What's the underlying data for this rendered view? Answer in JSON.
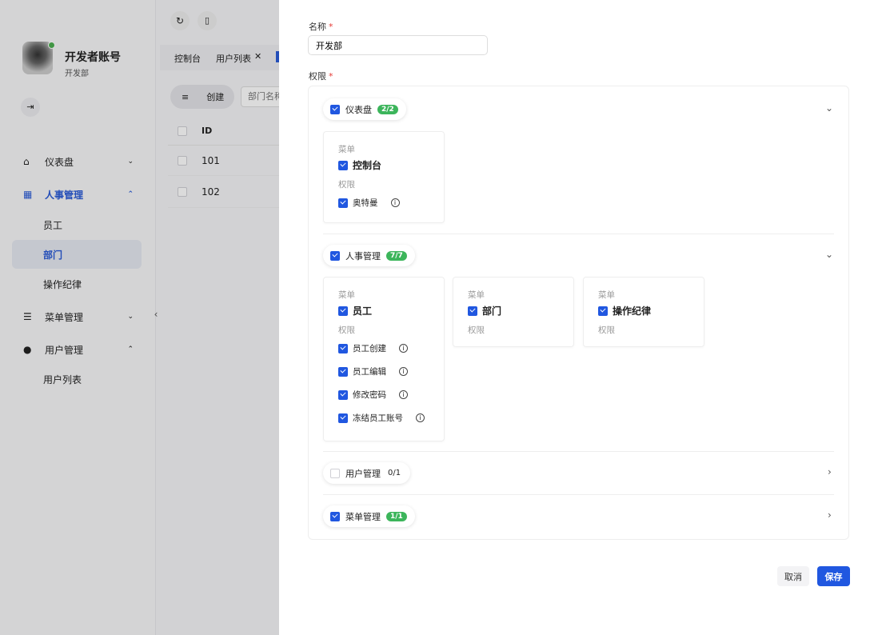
{
  "sidebar": {
    "user_name": "开发者账号",
    "user_dept": "开发部",
    "items": [
      {
        "label": "仪表盘",
        "icon": "home-icon"
      },
      {
        "label": "人事管理",
        "icon": "team-icon"
      },
      {
        "label": "员工"
      },
      {
        "label": "部门"
      },
      {
        "label": "操作纪律"
      },
      {
        "label": "菜单管理",
        "icon": "list-icon"
      },
      {
        "label": "用户管理",
        "icon": "users-icon"
      },
      {
        "label": "用户列表"
      }
    ]
  },
  "main": {
    "tabs": [
      "控制台",
      "用户列表"
    ],
    "create_label": "创建",
    "search_placeholder": "部门名称",
    "id_header": "ID",
    "rows": [
      "101",
      "102"
    ]
  },
  "drawer": {
    "name_label": "名称",
    "name_value": "开发部",
    "perm_label": "权限",
    "groups": [
      {
        "label": "仪表盘",
        "count": "2/2",
        "checked": true,
        "expanded": true,
        "cards": [
          {
            "menu_title": "菜单",
            "menu": "控制台",
            "perm_title": "权限",
            "perms": [
              "奥特曼"
            ]
          }
        ]
      },
      {
        "label": "人事管理",
        "count": "7/7",
        "checked": true,
        "expanded": true,
        "cards": [
          {
            "menu_title": "菜单",
            "menu": "员工",
            "perm_title": "权限",
            "perms": [
              "员工创建",
              "员工编辑",
              "修改密码",
              "冻结员工账号"
            ]
          },
          {
            "menu_title": "菜单",
            "menu": "部门",
            "perm_title": "权限",
            "perms": []
          },
          {
            "menu_title": "菜单",
            "menu": "操作纪律",
            "perm_title": "权限",
            "perms": []
          }
        ]
      },
      {
        "label": "用户管理",
        "count": "0/1",
        "checked": false,
        "expanded": false
      },
      {
        "label": "菜单管理",
        "count": "1/1",
        "checked": true,
        "expanded": false
      }
    ],
    "cancel": "取消",
    "save": "保存"
  },
  "colors": {
    "primary": "#2057e0",
    "badge": "#3cb55b"
  }
}
